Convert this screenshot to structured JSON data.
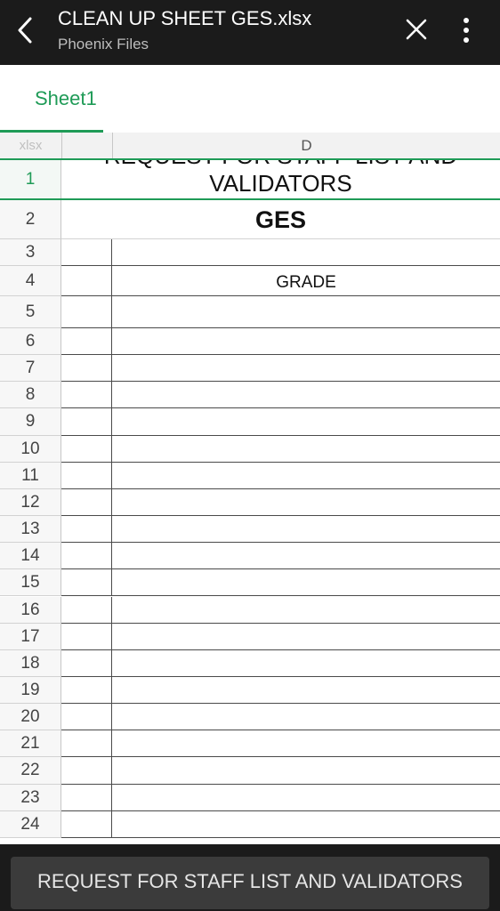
{
  "appbar": {
    "title": "CLEAN UP SHEET GES.xlsx",
    "subtitle": "Phoenix Files",
    "back_icon": "back-arrow-icon",
    "close_icon": "close-icon",
    "more_icon": "more-vert-icon"
  },
  "tabs": [
    {
      "label": "Sheet1",
      "active": true
    }
  ],
  "grid": {
    "corner_label": "xlsx",
    "column_headers": [
      "",
      "D"
    ],
    "row_headers": [
      "1",
      "2",
      "3",
      "4",
      "5",
      "6",
      "7",
      "8",
      "9",
      "10",
      "11",
      "12",
      "13",
      "14",
      "15",
      "16",
      "17",
      "18",
      "19",
      "20",
      "21",
      "22",
      "23",
      "24"
    ],
    "row1_ghost": "REQUEST FOR STAFF LIST AND",
    "row1_text": "VALIDATORS",
    "row2_text": "GES",
    "row4_d": "GRADE"
  },
  "formula_bar": {
    "text": "REQUEST FOR STAFF LIST AND VALIDATORS"
  },
  "colors": {
    "accent": "#1f9b57",
    "appbar_bg": "#1b1b1b"
  }
}
